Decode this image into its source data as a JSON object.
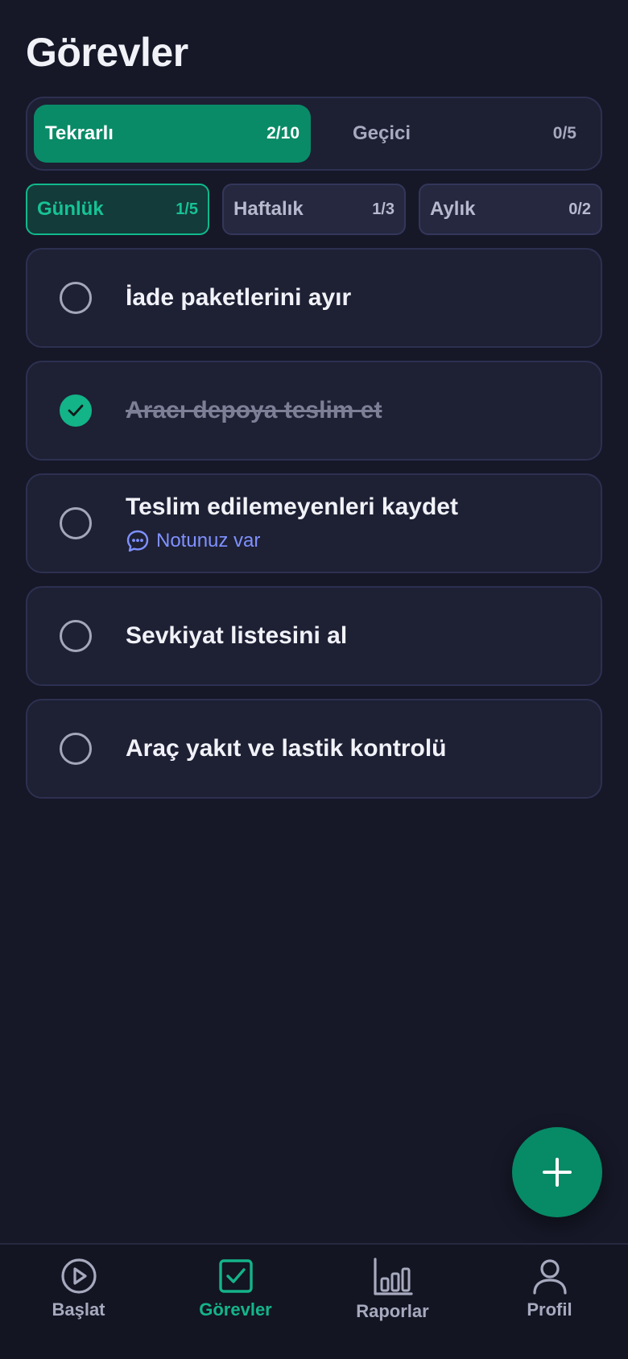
{
  "page_title": "Görevler",
  "segment": {
    "active": {
      "label": "Tekrarlı",
      "count": "2/10"
    },
    "inactive": {
      "label": "Geçici",
      "count": "0/5"
    }
  },
  "filters": [
    {
      "label": "Günlük",
      "count": "1/5"
    },
    {
      "label": "Haftalık",
      "count": "1/3"
    },
    {
      "label": "Aylık",
      "count": "0/2"
    }
  ],
  "tasks": [
    {
      "title": "İade paketlerini ayır",
      "done": false
    },
    {
      "title": "Aracı depoya teslim et",
      "done": true
    },
    {
      "title": "Teslim edilemeyenleri kaydet",
      "done": false,
      "note": "Notunuz var"
    },
    {
      "title": "Sevkiyat listesini al",
      "done": false
    },
    {
      "title": "Araç yakıt ve lastik kontrolü",
      "done": false
    }
  ],
  "bottom_nav": [
    {
      "label": "Başlat",
      "icon": "play-circle-icon"
    },
    {
      "label": "Görevler",
      "icon": "checkbox-icon",
      "active": true
    },
    {
      "label": "Raporlar",
      "icon": "bar-chart-icon"
    },
    {
      "label": "Profil",
      "icon": "user-icon"
    }
  ],
  "colors": {
    "background": "#161828",
    "accent": "#098b67",
    "accent_text": "#17c394",
    "note": "#7f91ff"
  }
}
